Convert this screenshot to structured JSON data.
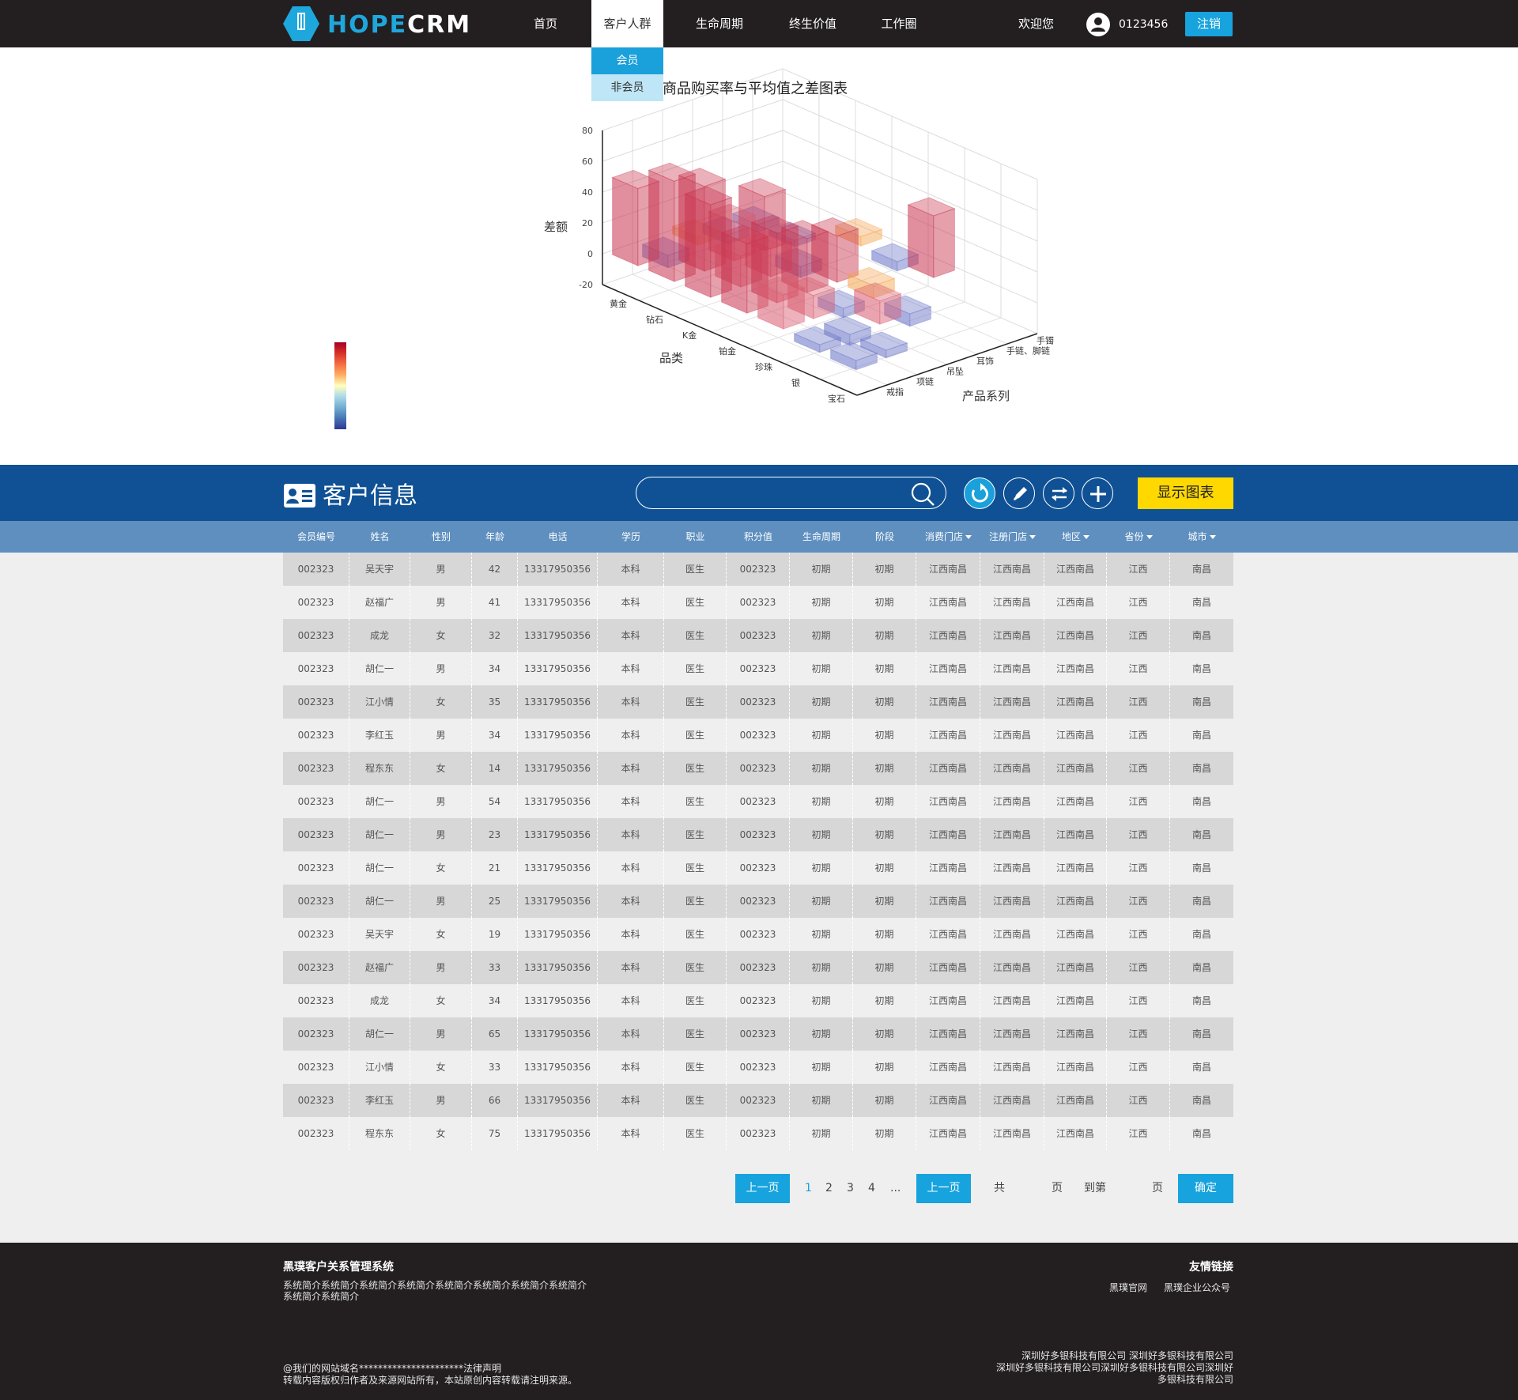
{
  "header": {
    "logo_text": "HOPE",
    "logo_text_suffix": "CRM",
    "nav": [
      "首页",
      "客户人群",
      "生命周期",
      "终生价值",
      "工作圈"
    ],
    "welcome": "欢迎您",
    "user_id": "0123456",
    "logout": "注销"
  },
  "dropdown": {
    "items": [
      "会员",
      "非会员"
    ]
  },
  "chart_data": {
    "type": "bar",
    "title": "商品购买率与平均值之差图表",
    "zlabel": "差额",
    "zlim": [
      -20,
      80
    ],
    "zticks": [
      80,
      60,
      40,
      20,
      0,
      -20
    ],
    "xlabel": "品类",
    "x": [
      "黄金",
      "钻石",
      "K金",
      "铂金",
      "珍珠",
      "银",
      "宝石"
    ],
    "ylabel": "产品系列",
    "y": [
      "手镯",
      "手链、脚链",
      "耳饰",
      "吊坠",
      "项链",
      "戒指"
    ],
    "colorbar": {
      "colors": [
        "#313695",
        "#4575b4",
        "#74add1",
        "#abd9e9",
        "#ffffbf",
        "#fdae61",
        "#f46d43",
        "#d73027",
        "#a50026"
      ]
    },
    "bars": [
      {
        "x": "黄金",
        "y": "戒指",
        "value": 50
      },
      {
        "x": "黄金",
        "y": "项链",
        "value": -8
      },
      {
        "x": "黄金",
        "y": "吊坠",
        "value": 5
      },
      {
        "x": "黄金",
        "y": "耳饰",
        "value": -6
      },
      {
        "x": "黄金",
        "y": "手链、脚链",
        "value": -5
      },
      {
        "x": "钻石",
        "y": "戒指",
        "value": 65
      },
      {
        "x": "钻石",
        "y": "项链",
        "value": 55
      },
      {
        "x": "钻石",
        "y": "吊坠",
        "value": 25
      },
      {
        "x": "钻石",
        "y": "耳饰",
        "value": 35
      },
      {
        "x": "钻石",
        "y": "手链、脚链",
        "value": -4
      },
      {
        "x": "K金",
        "y": "戒指",
        "value": 60
      },
      {
        "x": "K金",
        "y": "项链",
        "value": 20
      },
      {
        "x": "K金",
        "y": "吊坠",
        "value": 18
      },
      {
        "x": "K金",
        "y": "耳饰",
        "value": -7
      },
      {
        "x": "K金",
        "y": "手镯",
        "value": 6
      },
      {
        "x": "铂金",
        "y": "戒指",
        "value": 45
      },
      {
        "x": "铂金",
        "y": "项链",
        "value": 45
      },
      {
        "x": "铂金",
        "y": "吊坠",
        "value": 35
      },
      {
        "x": "铂金",
        "y": "耳饰",
        "value": 30
      },
      {
        "x": "铂金",
        "y": "手镯",
        "value": -6
      },
      {
        "x": "珍珠",
        "y": "戒指",
        "value": 22
      },
      {
        "x": "珍珠",
        "y": "项链",
        "value": 15
      },
      {
        "x": "珍珠",
        "y": "吊坠",
        "value": -6
      },
      {
        "x": "珍珠",
        "y": "耳饰",
        "value": 8
      },
      {
        "x": "珍珠",
        "y": "手镯",
        "value": 40
      },
      {
        "x": "银",
        "y": "戒指",
        "value": -5
      },
      {
        "x": "银",
        "y": "项链",
        "value": -7
      },
      {
        "x": "银",
        "y": "吊坠",
        "value": 15
      },
      {
        "x": "银",
        "y": "耳饰",
        "value": -8
      },
      {
        "x": "宝石",
        "y": "戒指",
        "value": -6
      },
      {
        "x": "宝石",
        "y": "项链",
        "value": -5
      }
    ],
    "grid": true,
    "legend": "colorbar-left"
  },
  "info": {
    "title": "客户信息",
    "search_placeholder": "",
    "show_chart": "显示图表"
  },
  "table": {
    "columns": [
      {
        "label": "会员编号",
        "dropdown": false
      },
      {
        "label": "姓名",
        "dropdown": false
      },
      {
        "label": "性别",
        "dropdown": false
      },
      {
        "label": "年龄",
        "dropdown": false
      },
      {
        "label": "电话",
        "dropdown": false
      },
      {
        "label": "学历",
        "dropdown": false
      },
      {
        "label": "职业",
        "dropdown": false
      },
      {
        "label": "积分值",
        "dropdown": false
      },
      {
        "label": "生命周期",
        "dropdown": false
      },
      {
        "label": "阶段",
        "dropdown": false
      },
      {
        "label": "消费门店",
        "dropdown": true
      },
      {
        "label": "注册门店",
        "dropdown": true
      },
      {
        "label": "地区",
        "dropdown": true
      },
      {
        "label": "省份",
        "dropdown": true
      },
      {
        "label": "城市",
        "dropdown": true
      }
    ],
    "rows": [
      [
        "002323",
        "吴天宇",
        "男",
        "42",
        "13317950356",
        "本科",
        "医生",
        "002323",
        "初期",
        "初期",
        "江西南昌",
        "江西南昌",
        "江西南昌",
        "江西",
        "南昌"
      ],
      [
        "002323",
        "赵福广",
        "男",
        "41",
        "13317950356",
        "本科",
        "医生",
        "002323",
        "初期",
        "初期",
        "江西南昌",
        "江西南昌",
        "江西南昌",
        "江西",
        "南昌"
      ],
      [
        "002323",
        "成龙",
        "女",
        "32",
        "13317950356",
        "本科",
        "医生",
        "002323",
        "初期",
        "初期",
        "江西南昌",
        "江西南昌",
        "江西南昌",
        "江西",
        "南昌"
      ],
      [
        "002323",
        "胡仁一",
        "男",
        "34",
        "13317950356",
        "本科",
        "医生",
        "002323",
        "初期",
        "初期",
        "江西南昌",
        "江西南昌",
        "江西南昌",
        "江西",
        "南昌"
      ],
      [
        "002323",
        "江小情",
        "女",
        "35",
        "13317950356",
        "本科",
        "医生",
        "002323",
        "初期",
        "初期",
        "江西南昌",
        "江西南昌",
        "江西南昌",
        "江西",
        "南昌"
      ],
      [
        "002323",
        "李红玉",
        "男",
        "34",
        "13317950356",
        "本科",
        "医生",
        "002323",
        "初期",
        "初期",
        "江西南昌",
        "江西南昌",
        "江西南昌",
        "江西",
        "南昌"
      ],
      [
        "002323",
        "程东东",
        "女",
        "14",
        "13317950356",
        "本科",
        "医生",
        "002323",
        "初期",
        "初期",
        "江西南昌",
        "江西南昌",
        "江西南昌",
        "江西",
        "南昌"
      ],
      [
        "002323",
        "胡仁一",
        "男",
        "54",
        "13317950356",
        "本科",
        "医生",
        "002323",
        "初期",
        "初期",
        "江西南昌",
        "江西南昌",
        "江西南昌",
        "江西",
        "南昌"
      ],
      [
        "002323",
        "胡仁一",
        "男",
        "23",
        "13317950356",
        "本科",
        "医生",
        "002323",
        "初期",
        "初期",
        "江西南昌",
        "江西南昌",
        "江西南昌",
        "江西",
        "南昌"
      ],
      [
        "002323",
        "胡仁一",
        "女",
        "21",
        "13317950356",
        "本科",
        "医生",
        "002323",
        "初期",
        "初期",
        "江西南昌",
        "江西南昌",
        "江西南昌",
        "江西",
        "南昌"
      ],
      [
        "002323",
        "胡仁一",
        "男",
        "25",
        "13317950356",
        "本科",
        "医生",
        "002323",
        "初期",
        "初期",
        "江西南昌",
        "江西南昌",
        "江西南昌",
        "江西",
        "南昌"
      ],
      [
        "002323",
        "吴天宇",
        "女",
        "19",
        "13317950356",
        "本科",
        "医生",
        "002323",
        "初期",
        "初期",
        "江西南昌",
        "江西南昌",
        "江西南昌",
        "江西",
        "南昌"
      ],
      [
        "002323",
        "赵福广",
        "男",
        "33",
        "13317950356",
        "本科",
        "医生",
        "002323",
        "初期",
        "初期",
        "江西南昌",
        "江西南昌",
        "江西南昌",
        "江西",
        "南昌"
      ],
      [
        "002323",
        "成龙",
        "女",
        "34",
        "13317950356",
        "本科",
        "医生",
        "002323",
        "初期",
        "初期",
        "江西南昌",
        "江西南昌",
        "江西南昌",
        "江西",
        "南昌"
      ],
      [
        "002323",
        "胡仁一",
        "男",
        "65",
        "13317950356",
        "本科",
        "医生",
        "002323",
        "初期",
        "初期",
        "江西南昌",
        "江西南昌",
        "江西南昌",
        "江西",
        "南昌"
      ],
      [
        "002323",
        "江小情",
        "女",
        "33",
        "13317950356",
        "本科",
        "医生",
        "002323",
        "初期",
        "初期",
        "江西南昌",
        "江西南昌",
        "江西南昌",
        "江西",
        "南昌"
      ],
      [
        "002323",
        "李红玉",
        "男",
        "66",
        "13317950356",
        "本科",
        "医生",
        "002323",
        "初期",
        "初期",
        "江西南昌",
        "江西南昌",
        "江西南昌",
        "江西",
        "南昌"
      ],
      [
        "002323",
        "程东东",
        "女",
        "75",
        "13317950356",
        "本科",
        "医生",
        "002323",
        "初期",
        "初期",
        "江西南昌",
        "江西南昌",
        "江西南昌",
        "江西",
        "南昌"
      ]
    ]
  },
  "pagination": {
    "prev1": "上一页",
    "pages": [
      "1",
      "2",
      "3",
      "4",
      "..."
    ],
    "current": "1",
    "prev2": "上一页",
    "total_prefix": "共",
    "total_suffix": "页",
    "goto_prefix": "到第",
    "goto_suffix": "页",
    "confirm": "确定"
  },
  "footer": {
    "title": "黑璞客户关系管理系统",
    "intro": "系统简介系统简介系统简介系统简介系统简介系统简介系统简介系统简介系统简介系统简介",
    "links_title": "友情链接",
    "links": [
      "黑璞官网",
      "黑璞企业公众号"
    ],
    "legal_line1": "@我们的网站域名**********************法律声明",
    "legal_line2": "转载内容版权归作者及来源网站所有，本站原创内容转载请注明来源。",
    "company_line1": "深圳好多银科技有限公司 深圳好多银科技有限公司",
    "company_line2": "深圳好多银科技有限公司深圳好多银科技有限公司深圳好",
    "company_line3": "多银科技有限公司"
  },
  "colors": {
    "topbar": "#231f20",
    "accent": "#17a3dd",
    "info_bar": "#0f5194",
    "table_head": "#5e8fbf",
    "yellow": "#ffd800",
    "bar_red": "#c8334e",
    "bar_blue": "#6f79c8",
    "bar_orange": "#f4a24b"
  }
}
